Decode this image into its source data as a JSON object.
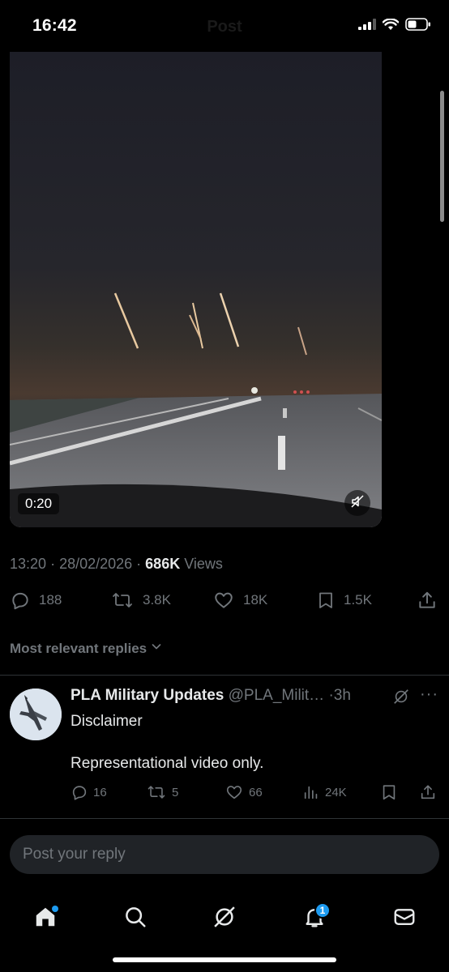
{
  "status_bar": {
    "time": "16:42",
    "header_title": "Post"
  },
  "video": {
    "duration": "0:20"
  },
  "post_meta": {
    "time": "13:20",
    "date": "28/02/2026",
    "views_count": "686K",
    "views_label": "Views"
  },
  "actions": {
    "replies": "188",
    "reposts": "3.8K",
    "likes": "18K",
    "bookmarks": "1.5K"
  },
  "replies_sort": {
    "label": "Most relevant replies"
  },
  "reply": {
    "name": "PLA Military Updates",
    "handle": "@PLA_Milit…",
    "time": "3h",
    "text_line1": "Disclaimer",
    "text_line2": "Representational video only.",
    "replies": "16",
    "reposts": "5",
    "likes": "66",
    "views": "24K"
  },
  "composer": {
    "placeholder": "Post your reply"
  },
  "bottom_nav": {
    "notifications_badge": "1"
  },
  "colors": {
    "background": "#000000",
    "text_primary": "#e7e9ea",
    "text_secondary": "#71767b",
    "accent": "#1d9bf0",
    "divider": "#2f3336"
  }
}
